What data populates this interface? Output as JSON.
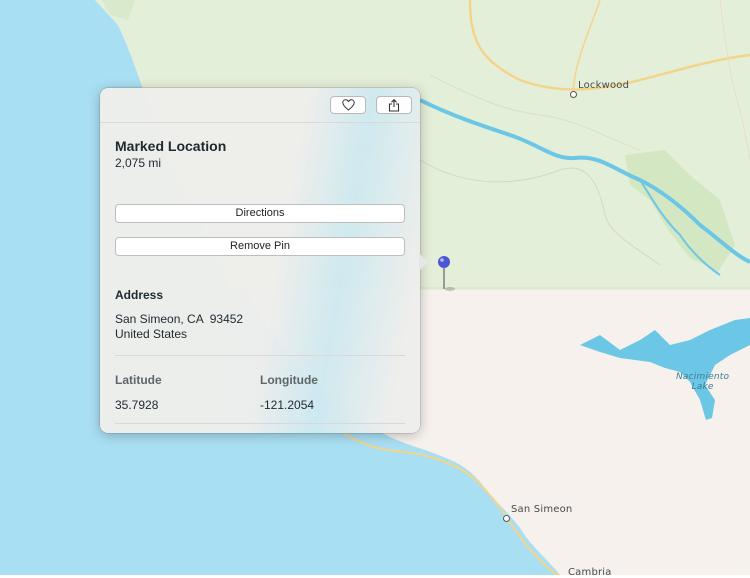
{
  "map": {
    "labels": {
      "lockwood": "Lockwood",
      "nacimiento_lake": "Nacimiento\nLake",
      "san_simeon": "San Simeon",
      "cambria": "Cambria"
    },
    "colors": {
      "ocean": "#a9dff2",
      "land": "#f6f1ec",
      "forest": "#e4efd9",
      "forest_dark": "#d3e7c3",
      "water": "#6cc7e6",
      "road": "#f4d48a"
    }
  },
  "popover": {
    "title": "Marked Location",
    "distance": "2,075 mi",
    "buttons": {
      "directions": "Directions",
      "remove_pin": "Remove Pin"
    },
    "address": {
      "heading": "Address",
      "line1": "San Simeon, CA  93452",
      "line2": "United States"
    },
    "coordinates": {
      "latitude_label": "Latitude",
      "latitude": "35.7928",
      "longitude_label": "Longitude",
      "longitude": "-121.2054"
    },
    "toolbar": {
      "favorite_icon": "heart-icon",
      "share_icon": "share-icon"
    }
  },
  "pin": {
    "color": "#4a56d6"
  }
}
